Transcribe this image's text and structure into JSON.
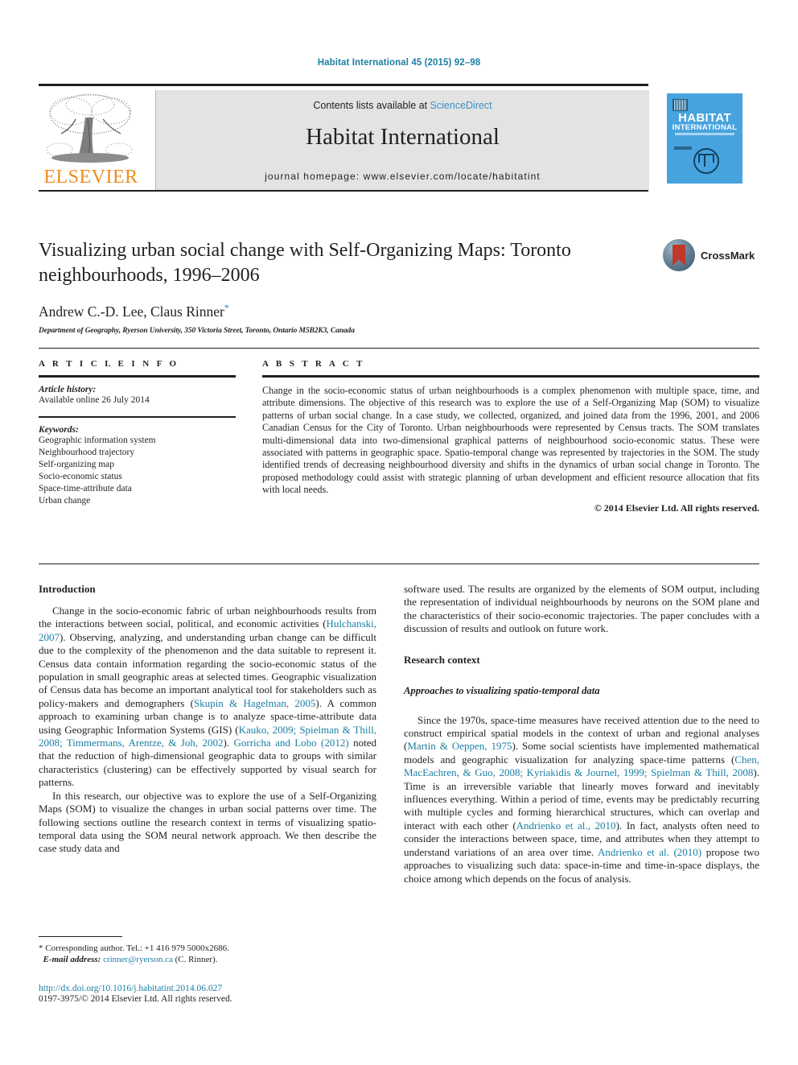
{
  "running_head": "Habitat International 45 (2015) 92–98",
  "masthead": {
    "contents_prefix": "Contents lists available at ",
    "sciencedirect": "ScienceDirect",
    "journal_title": "Habitat International",
    "homepage": "journal homepage: www.elsevier.com/locate/habitatint",
    "publisher_logo_text": "ELSEVIER",
    "cover": {
      "line1": "HABITAT",
      "line2": "INTERNATIONAL"
    },
    "colors": {
      "link_blue": "#3f8fc4",
      "elsevier_orange": "#f08c1e",
      "cover_blue": "#47a3dd",
      "band_gray": "#e3e3e3"
    }
  },
  "article": {
    "title": "Visualizing urban social change with Self-Organizing Maps: Toronto neighbourhoods, 1996–2006",
    "authors": "Andrew C.-D. Lee, Claus Rinner",
    "corresponding_marker": "*",
    "affiliation": "Department of Geography, Ryerson University, 350 Victoria Street, Toronto, Ontario M5B2K3, Canada",
    "crossmark_label": "CrossMark"
  },
  "article_info": {
    "heading": "A R T I C L E   I N F O",
    "history_label": "Article history:",
    "history_value": "Available online 26 July 2014",
    "keywords_label": "Keywords:",
    "keywords": [
      "Geographic information system",
      "Neighbourhood trajectory",
      "Self-organizing map",
      "Socio-economic status",
      "Space-time-attribute data",
      "Urban change"
    ]
  },
  "abstract": {
    "heading": "A B S T R A C T",
    "text": "Change in the socio-economic status of urban neighbourhoods is a complex phenomenon with multiple space, time, and attribute dimensions. The objective of this research was to explore the use of a Self-Organizing Map (SOM) to visualize patterns of urban social change. In a case study, we collected, organized, and joined data from the 1996, 2001, and 2006 Canadian Census for the City of Toronto. Urban neighbourhoods were represented by Census tracts. The SOM translates multi-dimensional data into two-dimensional graphical patterns of neighbourhood socio-economic status. These were associated with patterns in geographic space. Spatio-temporal change was represented by trajectories in the SOM. The study identified trends of decreasing neighbourhood diversity and shifts in the dynamics of urban social change in Toronto. The proposed methodology could assist with strategic planning of urban development and efficient resource allocation that fits with local needs.",
    "copyright": "© 2014 Elsevier Ltd. All rights reserved."
  },
  "body": {
    "left": {
      "intro_heading": "Introduction",
      "p1_a": "Change in the socio-economic fabric of urban neighbourhoods results from the interactions between social, political, and economic activities (",
      "p1_cite1": "Hulchanski, 2007",
      "p1_b": "). Observing, analyzing, and understanding urban change can be difficult due to the complexity of the phenomenon and the data suitable to represent it. Census data contain information regarding the socio-economic status of the population in small geographic areas at selected times. Geographic visualization of Census data has become an important analytical tool for stakeholders such as policy-makers and demographers (",
      "p1_cite2": "Skupin & Hagelman, 2005",
      "p1_c": "). A common approach to examining urban change is to analyze space-time-attribute data using Geographic Information Systems (GIS) (",
      "p1_cite3": "Kauko, 2009; Spielman & Thill, 2008; Timmermans, Arentze, & Joh, 2002",
      "p1_d": "). ",
      "p1_cite4": "Gorricha and Lobo (2012)",
      "p1_e": " noted that the reduction of high-dimensional geographic data to groups with similar characteristics (clustering) can be effectively supported by visual search for patterns.",
      "p2": "In this research, our objective was to explore the use of a Self-Organizing Maps (SOM) to visualize the changes in urban social patterns over time. The following sections outline the research context in terms of visualizing spatio-temporal data using the SOM neural network approach. We then describe the case study data and"
    },
    "right": {
      "p1": "software used. The results are organized by the elements of SOM output, including the representation of individual neighbourhoods by neurons on the SOM plane and the characteristics of their socio-economic trajectories. The paper concludes with a discussion of results and outlook on future work.",
      "research_context_heading": "Research context",
      "approaches_heading": "Approaches to visualizing spatio-temporal data",
      "p2_a": "Since the 1970s, space-time measures have received attention due to the need to construct empirical spatial models in the context of urban and regional analyses (",
      "p2_cite1": "Martin & Oeppen, 1975",
      "p2_b": "). Some social scientists have implemented mathematical models and geographic visualization for analyzing space-time patterns (",
      "p2_cite2": "Chen, MacEachren, & Guo, 2008; Kyriakidis & Journel, 1999; Spielman & Thill, 2008",
      "p2_c": "). Time is an irreversible variable that linearly moves forward and inevitably influences everything. Within a period of time, events may be predictably recurring with multiple cycles and forming hierarchical structures, which can overlap and interact with each other (",
      "p2_cite3": "Andrienko et al., 2010",
      "p2_d": "). In fact, analysts often need to consider the interactions between space, time, and attributes when they attempt to understand variations of an area over time. ",
      "p2_cite4": "Andrienko et al. (2010)",
      "p2_e": " propose two approaches to visualizing such data: space-in-time and time-in-space displays, the choice among which depends on the focus of analysis."
    }
  },
  "footer": {
    "corresponding": "* Corresponding author. Tel.: +1 416 979 5000x2686.",
    "email_label": "E-mail address:",
    "email": "crinner@ryerson.ca",
    "email_suffix": " (C. Rinner).",
    "doi": "http://dx.doi.org/10.1016/j.habitatint.2014.06.027",
    "issn": "0197-3975/© 2014 Elsevier Ltd. All rights reserved."
  }
}
